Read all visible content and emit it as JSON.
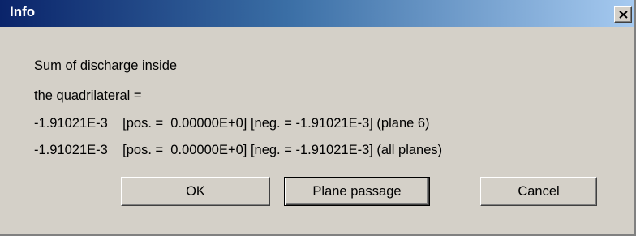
{
  "window": {
    "title": "Info",
    "close_glyph": "X"
  },
  "message": {
    "line1": "Sum of discharge inside",
    "line2": "the quadrilateral =",
    "line3": "-1.91021E-3    [pos. =  0.00000E+0] [neg. = -1.91021E-3] (plane 6)",
    "line4": "-1.91021E-3    [pos. =  0.00000E+0] [neg. = -1.91021E-3] (all planes)"
  },
  "buttons": {
    "ok": "OK",
    "plane_passage": "Plane passage",
    "cancel": "Cancel"
  },
  "icons": {
    "close": "close-icon"
  }
}
